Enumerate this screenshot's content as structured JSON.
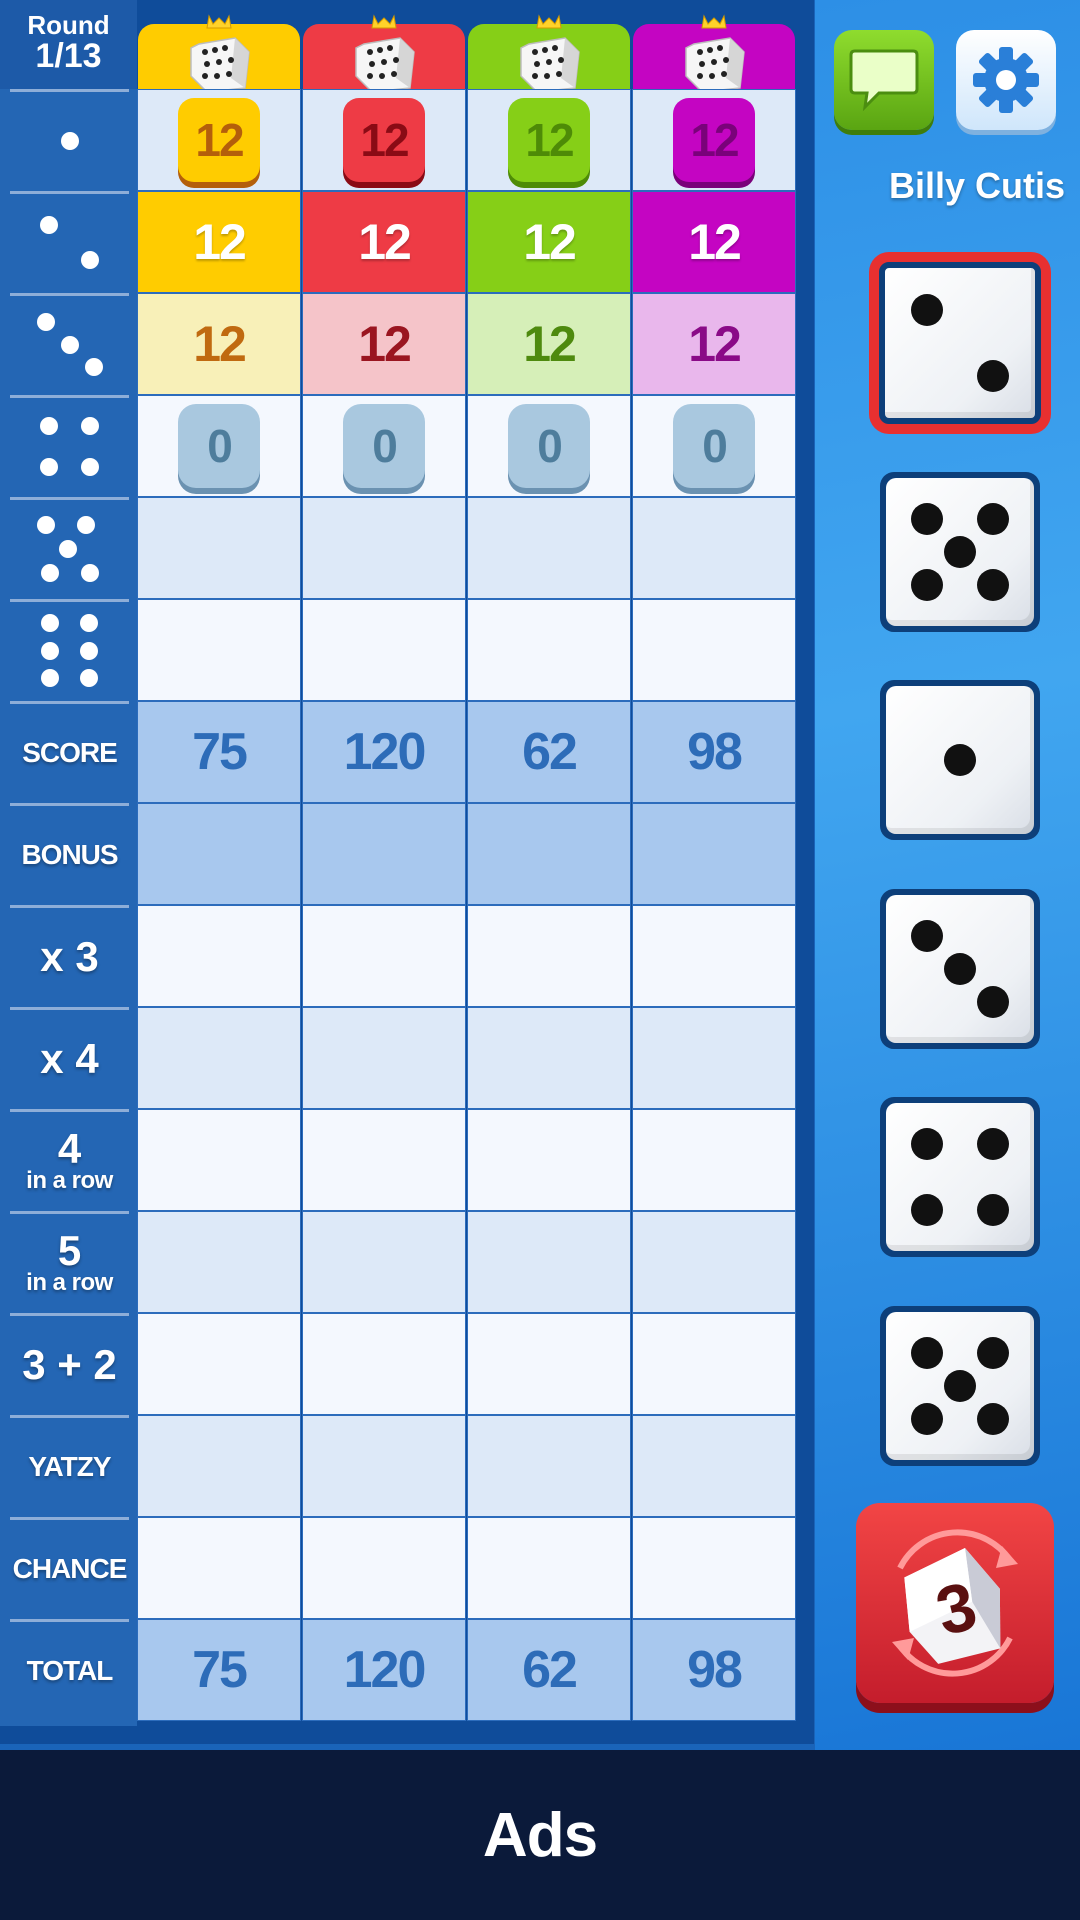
{
  "round": {
    "label": "Round",
    "value": "1/13"
  },
  "colors": {
    "players": [
      "#ffcc00",
      "#ee3b45",
      "#86cf17",
      "#c405c2"
    ],
    "players_tile_text": [
      "#b45f0b",
      "#8a0b15",
      "#4e8b07",
      "#7a027a"
    ],
    "players_pastel": [
      "#f8f0b8",
      "#f5c4c9",
      "#d6efb8",
      "#e9b7ec"
    ],
    "players_pastel_text": [
      "#c06a10",
      "#9a1520",
      "#4e8a0e",
      "#8a0a87"
    ],
    "score_text": "#2d6cb8"
  },
  "rows": {
    "ones": {
      "icon": "one-pip-icon"
    },
    "twos": {
      "icon": "two-pip-icon"
    },
    "threes": {
      "icon": "three-pip-icon"
    },
    "fours": {
      "icon": "four-pip-icon"
    },
    "fives": {
      "icon": "five-pip-icon"
    },
    "sixes": {
      "icon": "six-pip-icon"
    },
    "score": {
      "label": "SCORE"
    },
    "bonus": {
      "label": "BONUS"
    },
    "x3": {
      "label": "x 3"
    },
    "x4": {
      "label": "x 4"
    },
    "four_row": {
      "num": "4",
      "sub": "in a row"
    },
    "five_row": {
      "num": "5",
      "sub": "in a row"
    },
    "full_house": {
      "label": "3 + 2"
    },
    "yatzy": {
      "label": "YATZY"
    },
    "chance": {
      "label": "CHANCE"
    },
    "total": {
      "label": "TOTAL"
    }
  },
  "players": [
    {
      "ones": "12",
      "twos": "12",
      "threes": "12",
      "fours": "0",
      "score": "75",
      "total": "75"
    },
    {
      "ones": "12",
      "twos": "12",
      "threes": "12",
      "fours": "0",
      "score": "120",
      "total": "120"
    },
    {
      "ones": "12",
      "twos": "12",
      "threes": "12",
      "fours": "0",
      "score": "62",
      "total": "62"
    },
    {
      "ones": "12",
      "twos": "12",
      "threes": "12",
      "fours": "0",
      "score": "98",
      "total": "98"
    }
  ],
  "right_panel": {
    "chat_icon": "chat-bubble-icon",
    "settings_icon": "gear-icon",
    "player_name": "Billy Cutis",
    "dice": [
      {
        "value": 2,
        "held": true
      },
      {
        "value": 5,
        "held": false
      },
      {
        "value": 1,
        "held": false
      },
      {
        "value": 3,
        "held": false
      },
      {
        "value": 4,
        "held": false
      },
      {
        "value": 5,
        "held": false
      }
    ],
    "roll_button": {
      "icon": "roll-dice-icon",
      "rolls_left": "3"
    }
  },
  "ads": {
    "label": "Ads"
  }
}
